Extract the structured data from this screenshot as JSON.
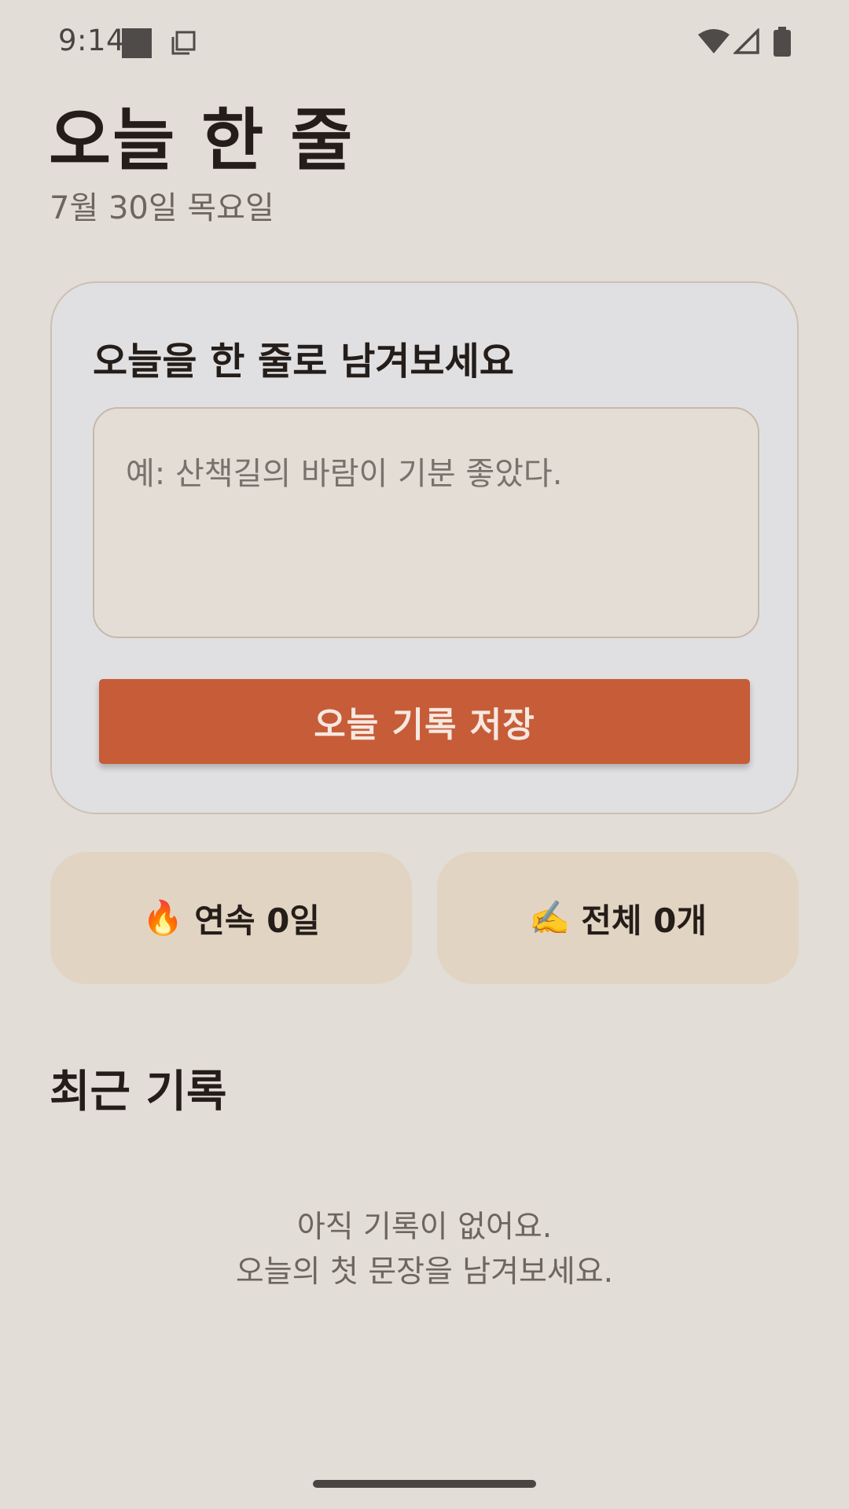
{
  "status_bar": {
    "time": "9:14",
    "icons": [
      "sim-icon",
      "copy-icon",
      "wifi-icon",
      "signal-icon",
      "battery-icon"
    ]
  },
  "header": {
    "title": "오늘 한 줄",
    "date": "7월 30일 목요일"
  },
  "entry_card": {
    "title": "오늘을 한 줄로 남겨보세요",
    "input_placeholder": "예: 산책길의 바람이 기분 좋았다.",
    "input_value": "",
    "save_label": "오늘 기록 저장"
  },
  "stats": {
    "streak": {
      "emoji": "🔥",
      "label": "연속 0일"
    },
    "total": {
      "emoji": "✍️",
      "label": "전체 0개"
    }
  },
  "recent": {
    "title": "최근 기록",
    "empty_line1": "아직 기록이 없어요.",
    "empty_line2": "오늘의 첫 문장을 남겨보세요."
  },
  "colors": {
    "background": "#e2ddd6",
    "card": "#e0e0e2",
    "accent": "#c65d38",
    "stat_card": "#e2d4c2",
    "text_primary": "#241d19",
    "text_secondary": "#6d655f"
  }
}
